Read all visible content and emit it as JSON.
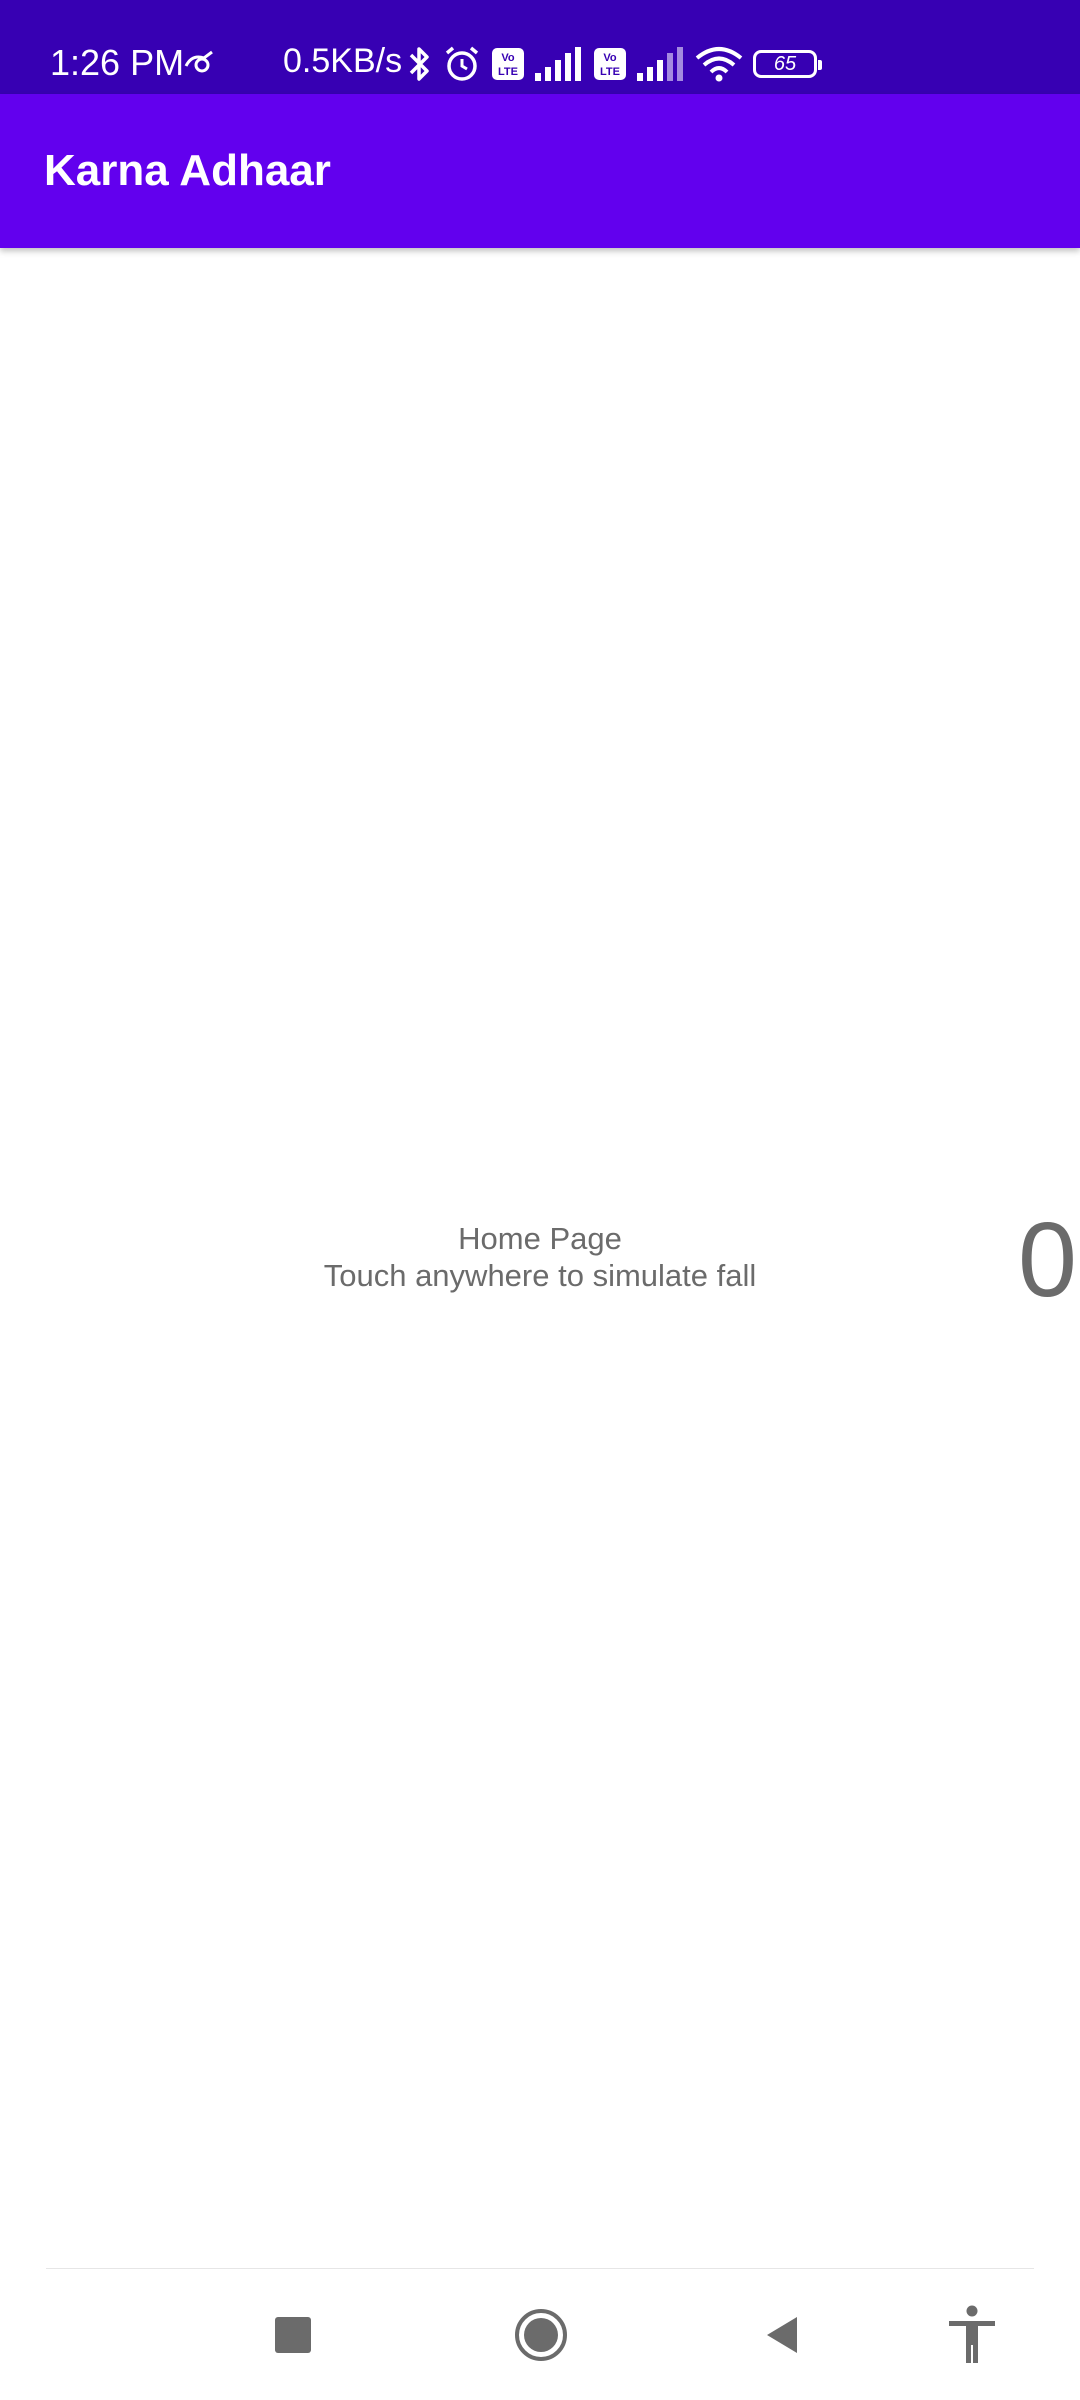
{
  "status_bar": {
    "time": "1:26 PM",
    "network_speed": "0.5KB/s",
    "battery_level": "65",
    "icons": [
      "vpn-icon",
      "bluetooth-icon",
      "alarm-icon",
      "volte-icon",
      "signal-icon",
      "volte-icon",
      "signal-icon",
      "wifi-icon",
      "battery-icon"
    ]
  },
  "app_bar": {
    "title": "Karna Adhaar"
  },
  "main": {
    "page_title": "Home Page",
    "instruction": "Touch anywhere to simulate fall",
    "counter": "0"
  },
  "nav_bar": {
    "icons": [
      "recents-icon",
      "home-icon",
      "back-icon",
      "accessibility-icon"
    ]
  },
  "colors": {
    "status_bar_bg": "#3700b3",
    "app_bar_bg": "#6200ee",
    "text_secondary": "#6b6b6b",
    "nav_icon": "#6b6b6b"
  }
}
